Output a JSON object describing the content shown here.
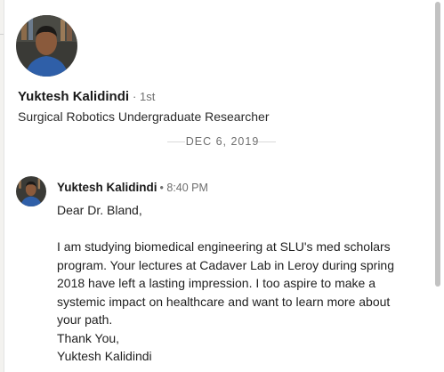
{
  "profile": {
    "name": "Yuktesh Kalidindi",
    "degree": "· 1st",
    "headline": "Surgical Robotics Undergraduate Researcher"
  },
  "conversation": {
    "date_divider": "DEC 6, 2019",
    "message": {
      "sender": "Yuktesh Kalidindi",
      "time": "• 8:40 PM",
      "greeting": "Dear Dr. Bland,",
      "lines": [
        "I am studying biomedical engineering at SLU's med scholars",
        "program. Your lectures at Cadaver Lab in Leroy during spring",
        "2018 have left a lasting impression. I too aspire to make a",
        "systemic impact on healthcare and want to learn more about",
        "your path.",
        "Thank You,",
        "Yuktesh Kalidindi"
      ]
    }
  },
  "colors": {
    "avatar_background": "#3a3a36",
    "shirt": "#2f5fa8",
    "skin": "#8a5a3c"
  }
}
